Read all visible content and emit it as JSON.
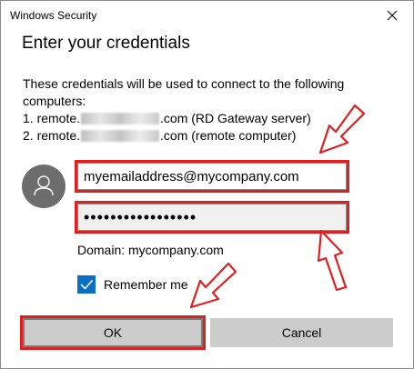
{
  "window": {
    "title": "Windows Security"
  },
  "dialog": {
    "heading": "Enter your credentials",
    "description": {
      "intro": "These credentials will be used to connect to the following",
      "intro2": "computers:",
      "computers": [
        {
          "prefix": "1. remote.",
          "suffix": ".com (RD Gateway server)"
        },
        {
          "prefix": "2. remote.",
          "suffix": ".com (remote computer)"
        }
      ]
    },
    "username": {
      "value": "myemailaddress@mycompany.com"
    },
    "password": {
      "value": "•••••••••••••••••"
    },
    "domain_text": "Domain: mycompany.com",
    "remember": {
      "label": "Remember me",
      "checked": true
    },
    "buttons": {
      "ok": "OK",
      "cancel": "Cancel"
    }
  },
  "colors": {
    "highlight": "#e01f1f",
    "accent": "#0a6fc2",
    "button_bg": "#cccccc",
    "avatar": "#6d6d6d"
  }
}
